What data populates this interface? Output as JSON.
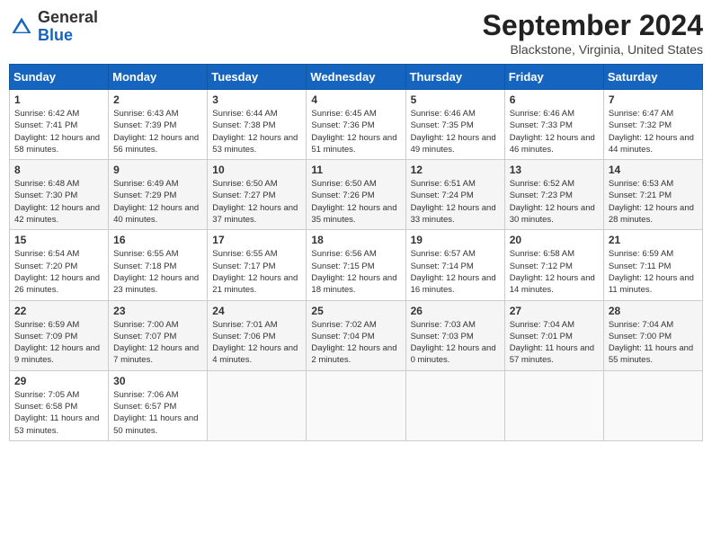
{
  "header": {
    "logo_general": "General",
    "logo_blue": "Blue",
    "month": "September 2024",
    "location": "Blackstone, Virginia, United States"
  },
  "weekdays": [
    "Sunday",
    "Monday",
    "Tuesday",
    "Wednesday",
    "Thursday",
    "Friday",
    "Saturday"
  ],
  "weeks": [
    [
      {
        "day": "1",
        "sunrise": "6:42 AM",
        "sunset": "7:41 PM",
        "daylight": "12 hours and 58 minutes."
      },
      {
        "day": "2",
        "sunrise": "6:43 AM",
        "sunset": "7:39 PM",
        "daylight": "12 hours and 56 minutes."
      },
      {
        "day": "3",
        "sunrise": "6:44 AM",
        "sunset": "7:38 PM",
        "daylight": "12 hours and 53 minutes."
      },
      {
        "day": "4",
        "sunrise": "6:45 AM",
        "sunset": "7:36 PM",
        "daylight": "12 hours and 51 minutes."
      },
      {
        "day": "5",
        "sunrise": "6:46 AM",
        "sunset": "7:35 PM",
        "daylight": "12 hours and 49 minutes."
      },
      {
        "day": "6",
        "sunrise": "6:46 AM",
        "sunset": "7:33 PM",
        "daylight": "12 hours and 46 minutes."
      },
      {
        "day": "7",
        "sunrise": "6:47 AM",
        "sunset": "7:32 PM",
        "daylight": "12 hours and 44 minutes."
      }
    ],
    [
      {
        "day": "8",
        "sunrise": "6:48 AM",
        "sunset": "7:30 PM",
        "daylight": "12 hours and 42 minutes."
      },
      {
        "day": "9",
        "sunrise": "6:49 AM",
        "sunset": "7:29 PM",
        "daylight": "12 hours and 40 minutes."
      },
      {
        "day": "10",
        "sunrise": "6:50 AM",
        "sunset": "7:27 PM",
        "daylight": "12 hours and 37 minutes."
      },
      {
        "day": "11",
        "sunrise": "6:50 AM",
        "sunset": "7:26 PM",
        "daylight": "12 hours and 35 minutes."
      },
      {
        "day": "12",
        "sunrise": "6:51 AM",
        "sunset": "7:24 PM",
        "daylight": "12 hours and 33 minutes."
      },
      {
        "day": "13",
        "sunrise": "6:52 AM",
        "sunset": "7:23 PM",
        "daylight": "12 hours and 30 minutes."
      },
      {
        "day": "14",
        "sunrise": "6:53 AM",
        "sunset": "7:21 PM",
        "daylight": "12 hours and 28 minutes."
      }
    ],
    [
      {
        "day": "15",
        "sunrise": "6:54 AM",
        "sunset": "7:20 PM",
        "daylight": "12 hours and 26 minutes."
      },
      {
        "day": "16",
        "sunrise": "6:55 AM",
        "sunset": "7:18 PM",
        "daylight": "12 hours and 23 minutes."
      },
      {
        "day": "17",
        "sunrise": "6:55 AM",
        "sunset": "7:17 PM",
        "daylight": "12 hours and 21 minutes."
      },
      {
        "day": "18",
        "sunrise": "6:56 AM",
        "sunset": "7:15 PM",
        "daylight": "12 hours and 18 minutes."
      },
      {
        "day": "19",
        "sunrise": "6:57 AM",
        "sunset": "7:14 PM",
        "daylight": "12 hours and 16 minutes."
      },
      {
        "day": "20",
        "sunrise": "6:58 AM",
        "sunset": "7:12 PM",
        "daylight": "12 hours and 14 minutes."
      },
      {
        "day": "21",
        "sunrise": "6:59 AM",
        "sunset": "7:11 PM",
        "daylight": "12 hours and 11 minutes."
      }
    ],
    [
      {
        "day": "22",
        "sunrise": "6:59 AM",
        "sunset": "7:09 PM",
        "daylight": "12 hours and 9 minutes."
      },
      {
        "day": "23",
        "sunrise": "7:00 AM",
        "sunset": "7:07 PM",
        "daylight": "12 hours and 7 minutes."
      },
      {
        "day": "24",
        "sunrise": "7:01 AM",
        "sunset": "7:06 PM",
        "daylight": "12 hours and 4 minutes."
      },
      {
        "day": "25",
        "sunrise": "7:02 AM",
        "sunset": "7:04 PM",
        "daylight": "12 hours and 2 minutes."
      },
      {
        "day": "26",
        "sunrise": "7:03 AM",
        "sunset": "7:03 PM",
        "daylight": "12 hours and 0 minutes."
      },
      {
        "day": "27",
        "sunrise": "7:04 AM",
        "sunset": "7:01 PM",
        "daylight": "11 hours and 57 minutes."
      },
      {
        "day": "28",
        "sunrise": "7:04 AM",
        "sunset": "7:00 PM",
        "daylight": "11 hours and 55 minutes."
      }
    ],
    [
      {
        "day": "29",
        "sunrise": "7:05 AM",
        "sunset": "6:58 PM",
        "daylight": "11 hours and 53 minutes."
      },
      {
        "day": "30",
        "sunrise": "7:06 AM",
        "sunset": "6:57 PM",
        "daylight": "11 hours and 50 minutes."
      },
      null,
      null,
      null,
      null,
      null
    ]
  ]
}
